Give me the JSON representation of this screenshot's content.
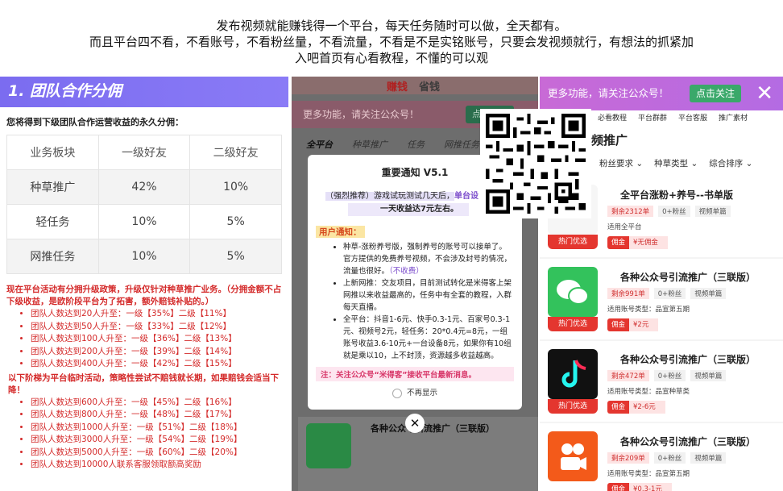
{
  "header": {
    "line1": "发布视频就能赚钱得一个平台，每天任务随时可以做，全天都有。",
    "line2": "而且平台四不看，不看账号，不看粉丝量，不看流量，不看是不是实铭账号，只要会发视频就行，有想法的抓紧加",
    "line3": "入吧首页有心看教程，不懂的可以观"
  },
  "panel1": {
    "title": "1. 团队合作分佣",
    "subtitle": "您将得到下级团队合作运营收益的永久分佣：",
    "table": {
      "headers": [
        "业务板块",
        "一级好友",
        "二级好友"
      ],
      "rows": [
        [
          "种草推广",
          "42%",
          "10%"
        ],
        [
          "轻任务",
          "10%",
          "5%"
        ],
        [
          "网推任务",
          "10%",
          "5%"
        ]
      ]
    },
    "note1": "现在平台活动有分拥升级政策，升级仅针对种草推广业务。（分拥金额不占下级收益，是欧阶段平台为了拓害，额外赔钱补贴的。）",
    "list1": [
      "团队人数达到20人升至：一级【35%】二级【11%】",
      "团队人数达到50人升至：一级【33%】二级【12%】",
      "团队人数达到100人升至：一级【36%】二级【13%】",
      "团队人数达到200人升至：一级【39%】二级【14%】",
      "团队人数达到400人升至：一级【42%】二级【15%】"
    ],
    "note2": "以下阶梯为平台临时活动，策略性尝试不赔钱就长期，如果赔钱会适当下降！",
    "list2": [
      "团队人数达到600人升至：一级【45%】二级【16%】",
      "团队人数达到800人升至：一级【48%】二级【17%】",
      "团队人数达到1000人升至：一级【51%】二级【18%】",
      "团队人数达到3000人升至：一级【54%】二级【19%】",
      "团队人数达到5000人升至：一级【60%】二级【20%】",
      "团队人数达到10000人联系客服领取额高奖励"
    ]
  },
  "panel2": {
    "tab_earn": "赚钱",
    "tab_save": "省钱",
    "banner_text": "更多功能，请关注公众号！",
    "banner_btn": "点击关注",
    "tabs": [
      "全平台",
      "种草推广",
      "任务",
      "网推任务"
    ],
    "card_title": "各种公众号引流推广（三联版）",
    "modal": {
      "title": "重要通知 V5.1",
      "line1_prefix": "（强烈推荐）",
      "line1_mid": "游戏试玩测试几天后，",
      "line1_bold": "单台设",
      "line2": "一天收益达7元左右。",
      "user_label": "用户通知：",
      "items": [
        "种草-涨粉养号版，强制养号的账号可以接单了。官方提供的免费养号视频，不会涉及封号的情况，流量也很好。",
        "上新网推：交友项目，目前测试转化是米得客上架网推以来收益最高的，任务中有全套的教程，入群每天直播。",
        "全平台：抖音1-6元、快手0.3-1元、百家号0.3-1元、视频号2元，轻任务：20*0.4元=8元，一组账号收益3.6-10元+一台设备8元，如果你有10组就是乘以10，上不封顶，资源越多收益越高。"
      ],
      "item1_suffix": "（不收费）",
      "note": "注：关注公众号“米得客”接收平台最新消息。",
      "checkbox_label": "不再显示"
    },
    "close_symbol": "✕"
  },
  "panel3": {
    "banner_text": "更多功能，请关注公众号！",
    "banner_btn": "点击关注",
    "banner_close": "✕",
    "icons": [
      "必看教程",
      "平台群群",
      "平台客服",
      "推广素材"
    ],
    "section_title": "频推广",
    "filters": [
      "粉丝要求 ⌄",
      "种草类型 ⌄",
      "综合排序 ⌄"
    ],
    "cards": [
      {
        "title": "全平台涨粉+养号--书单版",
        "remain": "剩余2312单",
        "fans": "0+粉丝",
        "type": "视频单篇",
        "req": "适用全平台",
        "comm_label": "佣金",
        "comm": "¥无佣金",
        "badge": "热门优选"
      },
      {
        "title": "各种公众号引流推广（三联版）",
        "remain": "剩余991单",
        "fans": "0+粉丝",
        "type": "视频单篇",
        "req": "适用账号类型：品宣第五期",
        "comm_label": "佣金",
        "comm": "¥2元",
        "badge": "热门优选"
      },
      {
        "title": "各种公众号引流推广（三联版）",
        "remain": "剩余472单",
        "fans": "0+粉丝",
        "type": "视频单篇",
        "req": "适用账号类型：品宣种草类",
        "comm_label": "佣金",
        "comm": "¥2-6元",
        "badge": "热门优选"
      },
      {
        "title": "各种公众号引流推广（三联版）",
        "remain": "剩余209单",
        "fans": "0+粉丝",
        "type": "视频单篇",
        "req": "适用账号类型：品宣第五期",
        "comm_label": "佣金",
        "comm": "¥0.3-1元",
        "badge": ""
      }
    ]
  }
}
